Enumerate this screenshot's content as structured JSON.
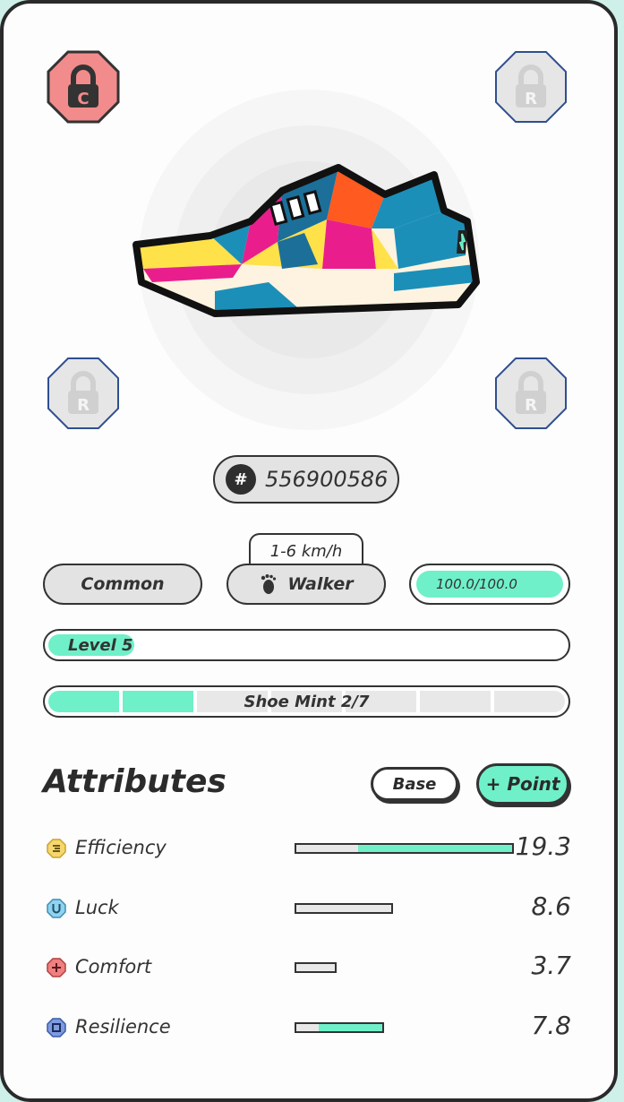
{
  "sneaker": {
    "sockets": [
      {
        "id": "top-left",
        "letter": "C",
        "state": "locked",
        "color": "#f08080"
      },
      {
        "id": "top-right",
        "letter": "R",
        "state": "locked",
        "color": "#e0e0e0"
      },
      {
        "id": "bottom-left",
        "letter": "R",
        "state": "locked",
        "color": "#e0e0e0"
      },
      {
        "id": "bottom-right",
        "letter": "R",
        "state": "locked",
        "color": "#e0e0e0"
      }
    ],
    "id_symbol": "#",
    "id": "556900586",
    "speed_range": "1-6 km/h",
    "rarity": "Common",
    "type": "Walker",
    "durability": "100.0/100.0",
    "level_label": "Level 5",
    "mint": {
      "label": "Shoe Mint 2/7",
      "done": 2,
      "total": 7
    }
  },
  "attributes": {
    "title": "Attributes",
    "base_button": "Base",
    "point_button": "+ Point",
    "items": [
      {
        "name": "Efficiency",
        "value": "19.3",
        "icon": "efficiency-icon",
        "icon_color": "#f5d76e",
        "base_fraction": 0.28,
        "total_fraction": 1.0
      },
      {
        "name": "Luck",
        "value": "8.6",
        "icon": "luck-icon",
        "icon_color": "#8fd3f0",
        "base_fraction": 0.45,
        "total_fraction": 0.45
      },
      {
        "name": "Comfort",
        "value": "3.7",
        "icon": "comfort-icon",
        "icon_color": "#f08080",
        "base_fraction": 0.19,
        "total_fraction": 0.19
      },
      {
        "name": "Resilience",
        "value": "7.8",
        "icon": "resilience-icon",
        "icon_color": "#7f9be0",
        "base_fraction": 0.1,
        "total_fraction": 0.41
      }
    ]
  },
  "colors": {
    "accent": "#6ff0c8",
    "outline": "#333333"
  }
}
